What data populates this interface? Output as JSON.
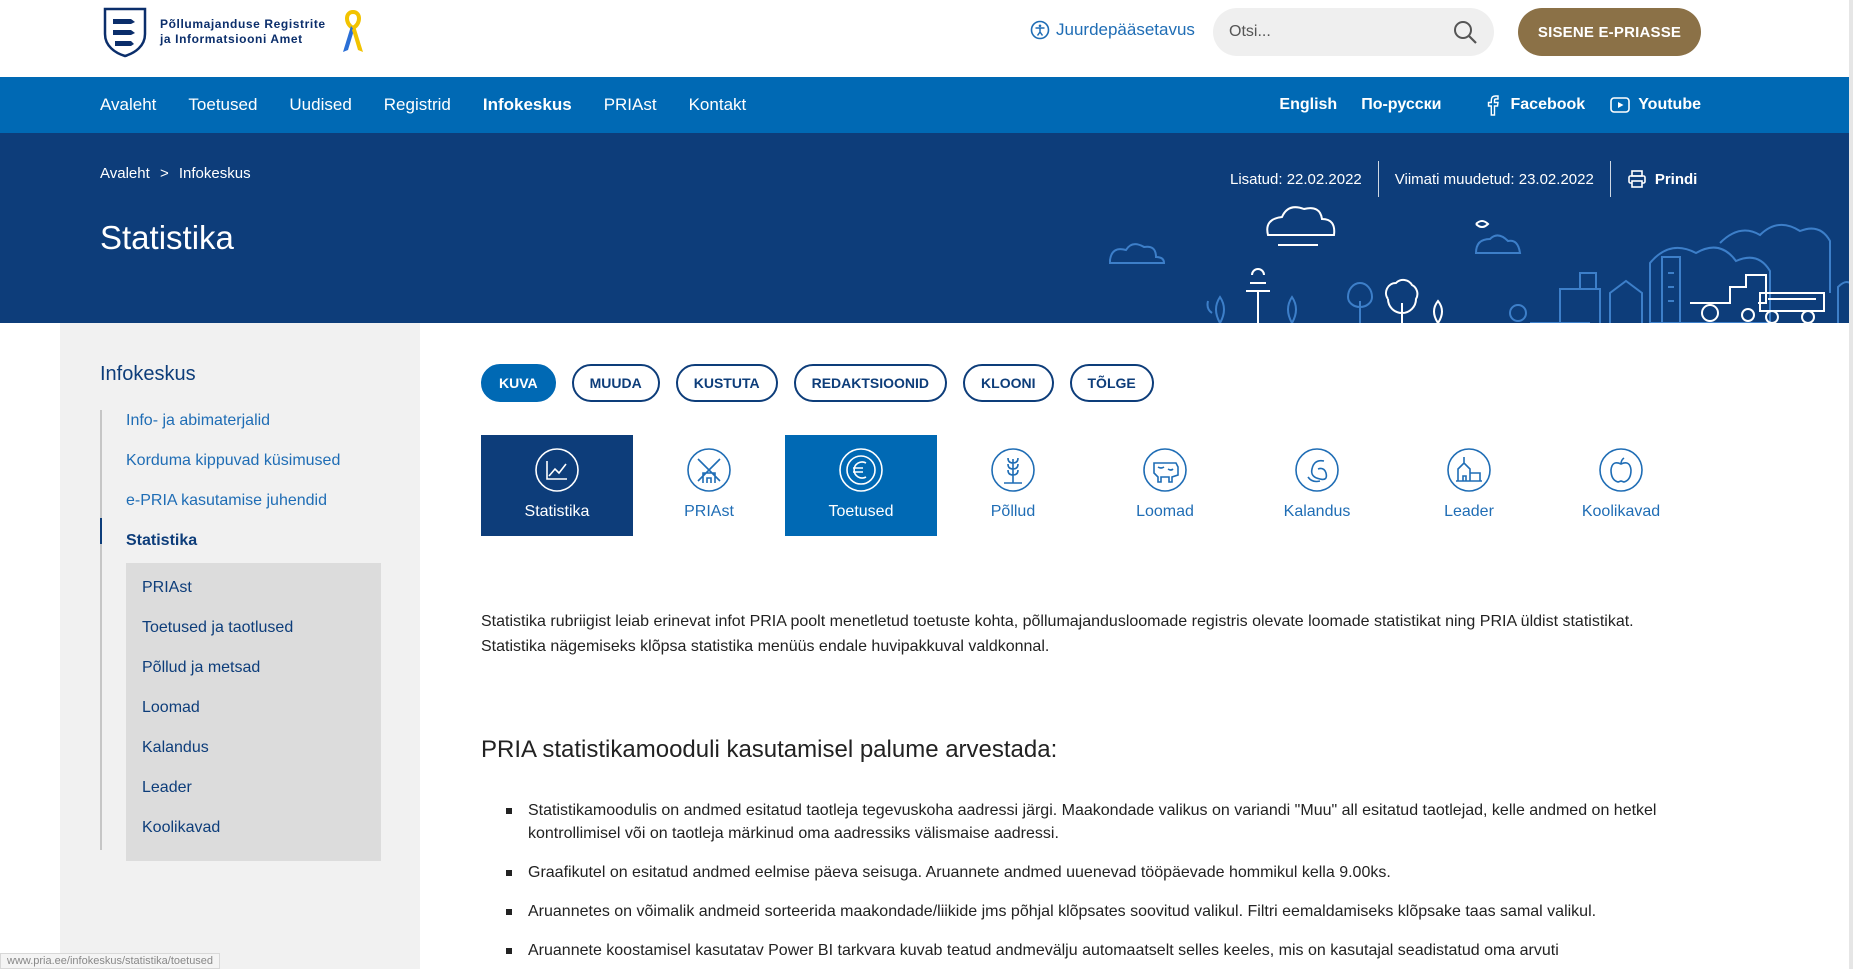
{
  "header": {
    "logo_line1": "Põllumajanduse Registrite",
    "logo_line2": "ja Informatsiooni Amet",
    "accessibility": "Juurdepääsetavus",
    "search_placeholder": "Otsi...",
    "eprs_button": "SISENE E-PRIASSE"
  },
  "nav": {
    "items": [
      {
        "label": "Avaleht"
      },
      {
        "label": "Toetused"
      },
      {
        "label": "Uudised"
      },
      {
        "label": "Registrid"
      },
      {
        "label": "Infokeskus"
      },
      {
        "label": "PRIAst"
      },
      {
        "label": "Kontakt"
      }
    ],
    "active": "Infokeskus",
    "lang_en": "English",
    "lang_ru": "По-русски",
    "facebook": "Facebook",
    "youtube": "Youtube"
  },
  "hero": {
    "breadcrumb_home": "Avaleht",
    "breadcrumb_sep": ">",
    "breadcrumb_current": "Infokeskus",
    "title": "Statistika",
    "added": "Lisatud: 22.02.2022",
    "modified": "Viimati muudetud: 23.02.2022",
    "print": "Prindi"
  },
  "sidebar": {
    "title": "Infokeskus",
    "items": [
      {
        "label": "Info- ja abimaterjalid"
      },
      {
        "label": "Korduma kippuvad küsimused"
      },
      {
        "label": "e-PRIA kasutamise juhendid"
      },
      {
        "label": "Statistika"
      }
    ],
    "subitems": [
      {
        "label": "PRIAst"
      },
      {
        "label": "Toetused ja taotlused"
      },
      {
        "label": "Põllud ja metsad"
      },
      {
        "label": "Loomad"
      },
      {
        "label": "Kalandus"
      },
      {
        "label": "Leader"
      },
      {
        "label": "Koolikavad"
      }
    ]
  },
  "pills": [
    {
      "label": "KUVA"
    },
    {
      "label": "MUUDA"
    },
    {
      "label": "KUSTUTA"
    },
    {
      "label": "REDAKTSIOONID"
    },
    {
      "label": "KLOONI"
    },
    {
      "label": "TÕLGE"
    }
  ],
  "tiles": [
    {
      "label": "Statistika",
      "icon": "chart-icon"
    },
    {
      "label": "PRIAst",
      "icon": "windmill-icon"
    },
    {
      "label": "Toetused",
      "icon": "euro-icon"
    },
    {
      "label": "Põllud",
      "icon": "wheat-icon"
    },
    {
      "label": "Loomad",
      "icon": "cow-icon"
    },
    {
      "label": "Kalandus",
      "icon": "fish-icon"
    },
    {
      "label": "Leader",
      "icon": "village-icon"
    },
    {
      "label": "Koolikavad",
      "icon": "apple-icon"
    }
  ],
  "content": {
    "intro": "Statistika rubriigist leiab erinevat infot PRIA poolt menetletud toetuste kohta, põllumajandusloomade registris olevate loomade statistikat ning PRIA üldist statistikat. Statistika nägemiseks klõpsa statistika menüüs endale huvipakkuval valdkonnal.",
    "heading": "PRIA statistikamooduli kasutamisel palume arvestada:",
    "bullets": [
      "Statistikamoodulis on andmed esitatud taotleja tegevuskoha aadressi järgi. Maakondade valikus on variandi \"Muu\" all esitatud taotlejad, kelle andmed on hetkel kontrollimisel või on taotleja märkinud oma aadressiks välismaise aadressi.",
      "Graafikutel on esitatud andmed eelmise päeva seisuga. Aruannete andmed uuenevad tööpäevade hommikul kella 9.00ks.",
      "Aruannetes on võimalik andmeid sorteerida maakondade/liikide jms põhjal klõpsates soovitud valikul. Filtri eemaldamiseks klõpsake taas samal valikul.",
      "Aruannete koostamisel kasutatav Power BI tarkvara kuvab teatud andmevälju automaatselt selles keeles, mis on kasutajal seadistatud oma arvuti"
    ]
  },
  "status_url": "www.pria.ee/infokeskus/statistika/toetused",
  "colors": {
    "nav_blue": "#0069b4",
    "hero_navy": "#0d3d7a",
    "gold_button": "#8b7147",
    "link_blue": "#1f6db5"
  }
}
